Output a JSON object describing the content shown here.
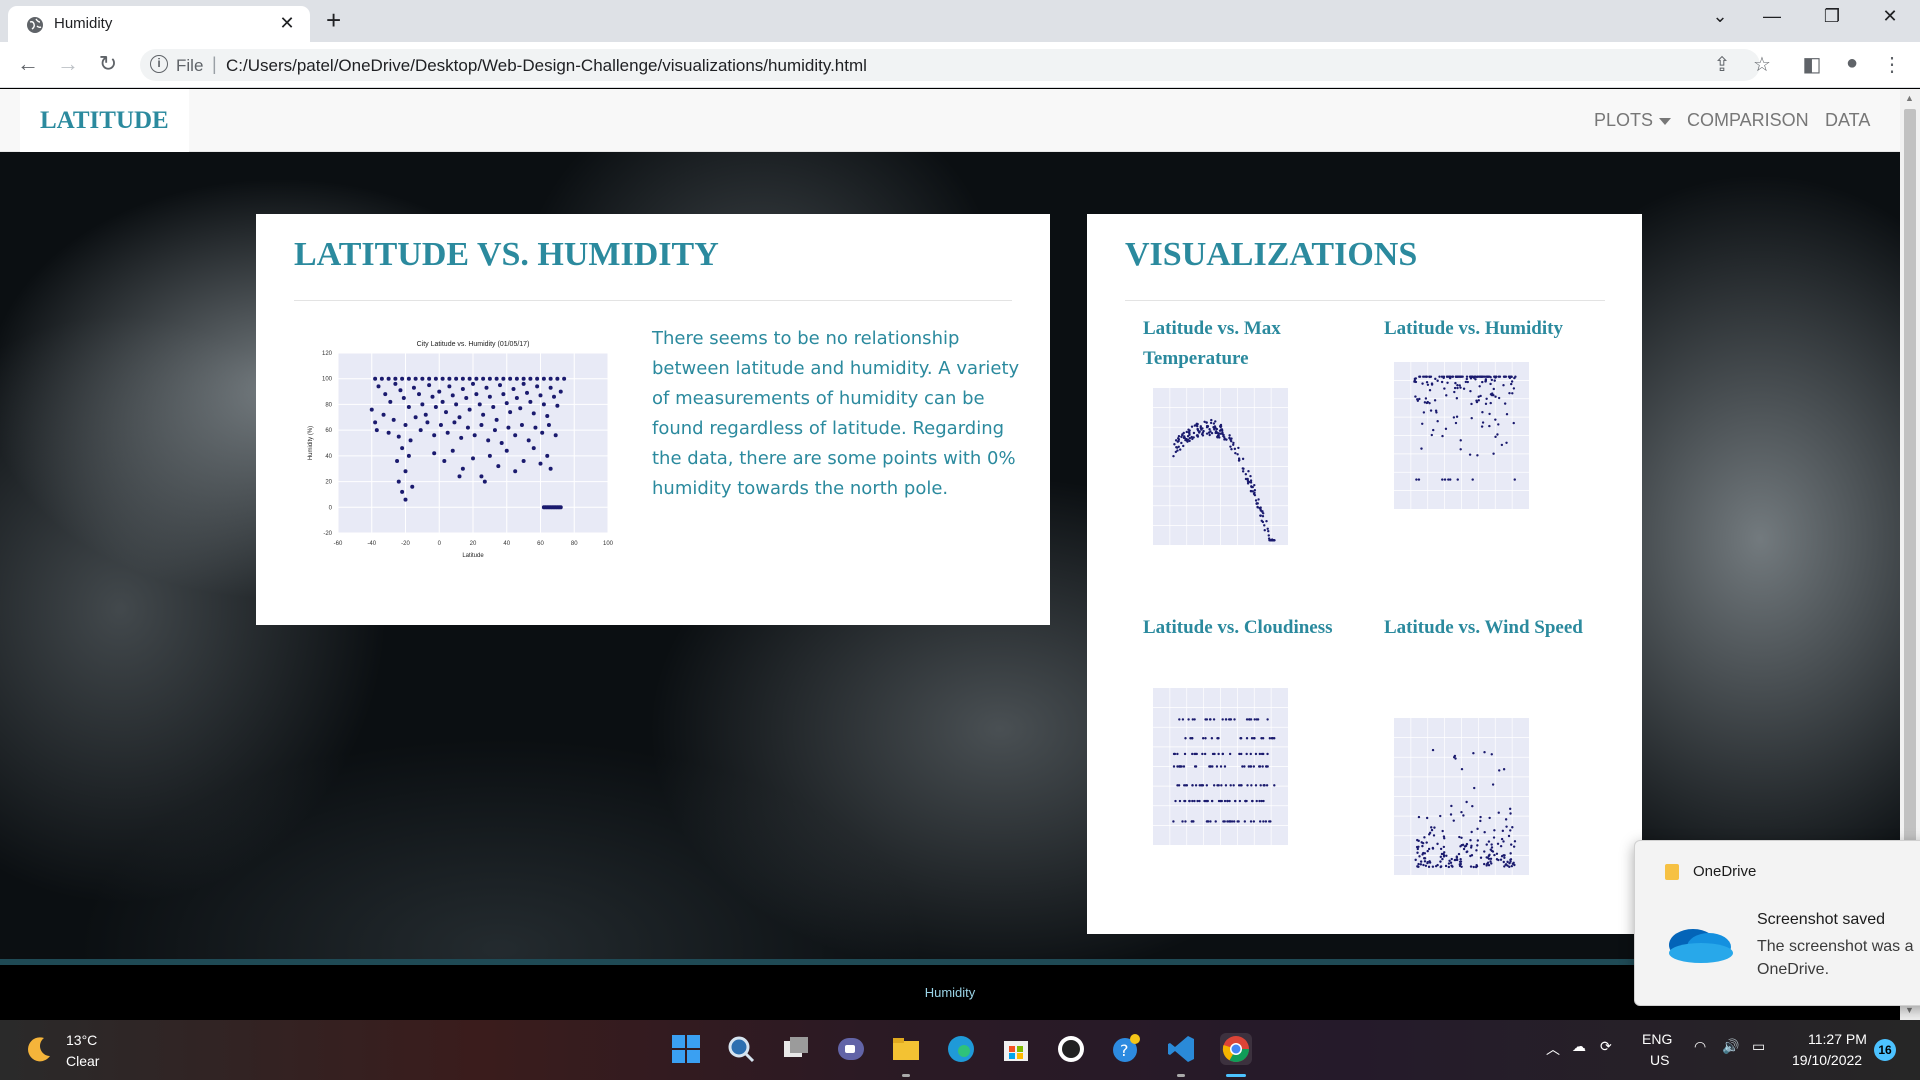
{
  "browser": {
    "tab_title": "Humidity",
    "new_tab_symbol": "+",
    "url_scheme_label": "File",
    "url": "C:/Users/patel/OneDrive/Desktop/Web-Design-Challenge/visualizations/humidity.html"
  },
  "site": {
    "brand": "LATITUDE",
    "nav": {
      "plots": "PLOTS",
      "comparison": "COMPARISON",
      "data": "DATA"
    }
  },
  "main_panel": {
    "heading": "LATITUDE VS. HUMIDITY",
    "description": "There seems to be no relationship between latitude and humidity. A variety of measurements of humidity can be found regardless of latitude. Regarding the data, there are some points with 0% humidity towards the north pole."
  },
  "chart_data": {
    "type": "scatter",
    "title": "City Latitude vs. Humidity (01/05/17)",
    "xlabel": "Latitude",
    "ylabel": "Humidity (%)",
    "xlim": [
      -60,
      100
    ],
    "ylim": [
      -20,
      120
    ],
    "x_ticks": [
      "-60",
      "-40",
      "-20",
      "0",
      "20",
      "40",
      "60",
      "80",
      "100"
    ],
    "y_ticks": [
      "-20",
      "0",
      "20",
      "40",
      "60",
      "80",
      "100",
      "120"
    ],
    "grid": true,
    "point_color": "#1a1a6e",
    "points": [
      [
        -38,
        100
      ],
      [
        -34,
        100
      ],
      [
        -30,
        100
      ],
      [
        -26,
        100
      ],
      [
        -22,
        100
      ],
      [
        -18,
        100
      ],
      [
        -14,
        100
      ],
      [
        -10,
        100
      ],
      [
        -6,
        100
      ],
      [
        -2,
        100
      ],
      [
        2,
        100
      ],
      [
        6,
        100
      ],
      [
        10,
        100
      ],
      [
        14,
        100
      ],
      [
        18,
        100
      ],
      [
        22,
        100
      ],
      [
        26,
        100
      ],
      [
        30,
        100
      ],
      [
        34,
        100
      ],
      [
        38,
        100
      ],
      [
        42,
        100
      ],
      [
        46,
        100
      ],
      [
        50,
        100
      ],
      [
        54,
        100
      ],
      [
        58,
        100
      ],
      [
        62,
        100
      ],
      [
        66,
        100
      ],
      [
        70,
        100
      ],
      [
        74,
        100
      ],
      [
        -36,
        94
      ],
      [
        -32,
        88
      ],
      [
        -29,
        82
      ],
      [
        -26,
        96
      ],
      [
        -23,
        91
      ],
      [
        -21,
        85
      ],
      [
        -18,
        78
      ],
      [
        -15,
        93
      ],
      [
        -12,
        88
      ],
      [
        -10,
        80
      ],
      [
        -8,
        72
      ],
      [
        -6,
        95
      ],
      [
        -4,
        86
      ],
      [
        -2,
        78
      ],
      [
        0,
        90
      ],
      [
        2,
        82
      ],
      [
        4,
        74
      ],
      [
        6,
        94
      ],
      [
        8,
        87
      ],
      [
        10,
        80
      ],
      [
        12,
        70
      ],
      [
        14,
        92
      ],
      [
        16,
        85
      ],
      [
        18,
        76
      ],
      [
        20,
        96
      ],
      [
        22,
        88
      ],
      [
        24,
        80
      ],
      [
        26,
        72
      ],
      [
        28,
        93
      ],
      [
        30,
        86
      ],
      [
        32,
        78
      ],
      [
        34,
        68
      ],
      [
        36,
        95
      ],
      [
        38,
        88
      ],
      [
        40,
        81
      ],
      [
        42,
        74
      ],
      [
        44,
        92
      ],
      [
        46,
        85
      ],
      [
        48,
        77
      ],
      [
        50,
        96
      ],
      [
        52,
        89
      ],
      [
        54,
        82
      ],
      [
        56,
        73
      ],
      [
        58,
        94
      ],
      [
        60,
        87
      ],
      [
        62,
        80
      ],
      [
        64,
        71
      ],
      [
        66,
        93
      ],
      [
        68,
        86
      ],
      [
        70,
        79
      ],
      [
        72,
        90
      ],
      [
        -40,
        76
      ],
      [
        -38,
        66
      ],
      [
        -37,
        60
      ],
      [
        -33,
        72
      ],
      [
        -30,
        58
      ],
      [
        -27,
        68
      ],
      [
        -24,
        55
      ],
      [
        -20,
        64
      ],
      [
        -17,
        52
      ],
      [
        -14,
        70
      ],
      [
        -11,
        60
      ],
      [
        -7,
        66
      ],
      [
        -3,
        56
      ],
      [
        1,
        64
      ],
      [
        5,
        58
      ],
      [
        9,
        66
      ],
      [
        13,
        54
      ],
      [
        17,
        62
      ],
      [
        21,
        56
      ],
      [
        25,
        64
      ],
      [
        29,
        52
      ],
      [
        33,
        60
      ],
      [
        37,
        50
      ],
      [
        41,
        62
      ],
      [
        45,
        56
      ],
      [
        49,
        64
      ],
      [
        53,
        52
      ],
      [
        57,
        62
      ],
      [
        61,
        58
      ],
      [
        65,
        64
      ],
      [
        69,
        56
      ],
      [
        -22,
        46
      ],
      [
        -18,
        40
      ],
      [
        -25,
        36
      ],
      [
        -20,
        28
      ],
      [
        -24,
        20
      ],
      [
        -16,
        16
      ],
      [
        -22,
        12
      ],
      [
        -20,
        6
      ],
      [
        -3,
        42
      ],
      [
        3,
        36
      ],
      [
        8,
        44
      ],
      [
        14,
        30
      ],
      [
        20,
        38
      ],
      [
        25,
        24
      ],
      [
        30,
        40
      ],
      [
        35,
        32
      ],
      [
        40,
        44
      ],
      [
        45,
        28
      ],
      [
        50,
        36
      ],
      [
        56,
        46
      ],
      [
        60,
        34
      ],
      [
        64,
        40
      ],
      [
        66,
        30
      ],
      [
        27,
        20
      ],
      [
        12,
        24
      ],
      [
        62,
        0
      ],
      [
        63,
        0
      ],
      [
        64,
        0
      ],
      [
        65,
        0
      ],
      [
        66,
        0
      ],
      [
        67,
        0
      ],
      [
        68,
        0
      ],
      [
        69,
        0
      ],
      [
        70,
        0
      ],
      [
        71,
        0
      ],
      [
        72,
        0
      ]
    ]
  },
  "viz_panel": {
    "heading": "VISUALIZATIONS",
    "items": [
      {
        "label": "Latitude vs. Max Temperature",
        "kind": "temperature"
      },
      {
        "label": "Latitude vs. Humidity",
        "kind": "humidity"
      },
      {
        "label": "Latitude vs. Cloudiness",
        "kind": "cloudiness"
      },
      {
        "label": "Latitude vs. Wind Speed",
        "kind": "wind"
      }
    ]
  },
  "footer": {
    "text": "Humidity"
  },
  "toast": {
    "app": "OneDrive",
    "title": "Screenshot saved",
    "body_line1": "The screenshot was a",
    "body_line2": "OneDrive."
  },
  "taskbar": {
    "temperature": "13°C",
    "condition": "Clear",
    "language": "ENG",
    "region": "US",
    "time": "11:27 PM",
    "date": "19/10/2022",
    "notifications": "16"
  }
}
